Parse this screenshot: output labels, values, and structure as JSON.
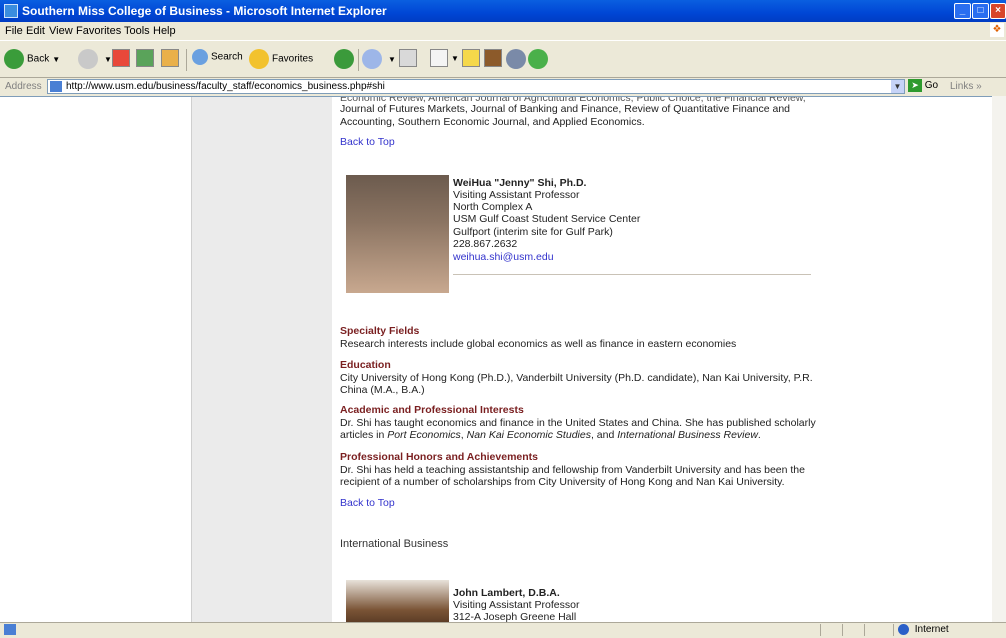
{
  "window": {
    "title": "Southern Miss College of Business - Microsoft Internet Explorer"
  },
  "menu": [
    "File",
    "Edit",
    "View",
    "Favorites",
    "Tools",
    "Help"
  ],
  "toolbar": {
    "back": "Back",
    "search": "Search",
    "favorites": "Favorites"
  },
  "address": {
    "label": "Address",
    "url": "http://www.usm.edu/business/faculty_staff/economics_business.php#shi",
    "go": "Go",
    "links": "Links"
  },
  "page": {
    "intro_line1": "Economic Review, American Journal of Agricultural Economics, Public Choice, the Financial Review,",
    "intro_line2": "Journal of Futures Markets, Journal of Banking and Finance, Review of Quantitative Finance and",
    "intro_line3": "Accounting, Southern Economic Journal, and Applied Economics.",
    "back_to_top": "Back to Top",
    "shi": {
      "name": "WeiHua \"Jenny\" Shi, Ph.D.",
      "title": "Visiting Assistant Professor",
      "office": "North Complex A",
      "center": "USM Gulf Coast Student Service Center",
      "site": "Gulfport (interim site for Gulf Park)",
      "phone": "228.867.2632",
      "email": "weihua.shi@usm.edu"
    },
    "specialty_heading": "Specialty Fields",
    "specialty_text": "Research interests include global economics as well as finance in eastern economies",
    "education_heading": "Education",
    "education_line1": "City University of Hong Kong (Ph.D.), Vanderbilt University (Ph.D. candidate), Nan Kai University, P.R.",
    "education_line2": "China (M.A., B.A.)",
    "academic_heading": "Academic and Professional Interests",
    "academic_line1": "Dr. Shi has taught economics and finance in the United States and China. She has published scholarly",
    "academic_line2_a": "articles in ",
    "academic_line2_b": "Port Economics",
    "academic_line2_c": ", ",
    "academic_line2_d": "Nan Kai Economic Studies",
    "academic_line2_e": ", and ",
    "academic_line2_f": "International Business Review",
    "academic_line2_g": ".",
    "honors_heading": "Professional Honors and Achievements",
    "honors_line1": "Dr. Shi has held a teaching assistantship and fellowship from Vanderbilt University and has been the",
    "honors_line2": "recipient of a number of scholarships from City University of Hong Kong and Nan Kai University.",
    "section_title": "International Business",
    "lambert": {
      "name": "John Lambert, D.B.A.",
      "title": "Visiting Assistant Professor",
      "office": "312-A Joseph Greene Hall"
    }
  },
  "status": {
    "zone": "Internet"
  }
}
